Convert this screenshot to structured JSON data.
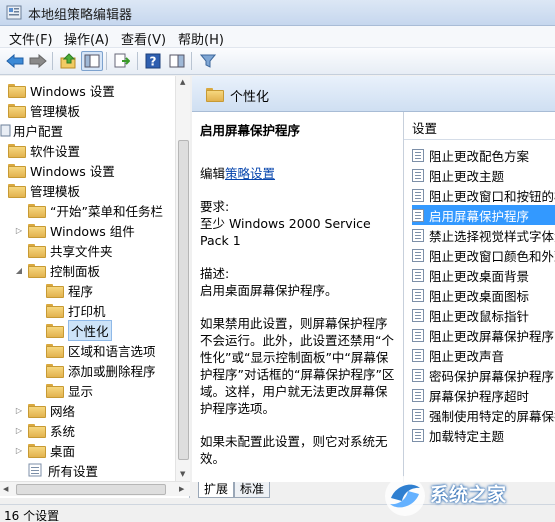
{
  "window": {
    "title": "本地组策略编辑器"
  },
  "menu": [
    "文件(F)",
    "操作(A)",
    "查看(V)",
    "帮助(H)"
  ],
  "icons": {
    "app": "policy-editor-icon",
    "back": "back-arrow-icon",
    "forward": "forward-arrow-icon",
    "up": "up-folder-icon",
    "show_hide_tree": "console-tree-icon",
    "export": "export-list-icon",
    "help": "help-icon",
    "show": "show-pane-icon",
    "filter": "filter-icon",
    "folder": "folder-icon",
    "setting": "setting-icon"
  },
  "tree": [
    {
      "label": "Windows 设置"
    },
    {
      "label": "管理模板"
    },
    {
      "label": "用户配置"
    },
    {
      "label": "软件设置"
    },
    {
      "label": "Windows 设置"
    },
    {
      "label": "管理模板"
    },
    {
      "label": "“开始”菜单和任务栏"
    },
    {
      "label": "Windows 组件"
    },
    {
      "label": "共享文件夹"
    },
    {
      "label": "控制面板"
    },
    {
      "label": "程序"
    },
    {
      "label": "打印机"
    },
    {
      "label": "个性化"
    },
    {
      "label": "区域和语言选项"
    },
    {
      "label": "添加或删除程序"
    },
    {
      "label": "显示"
    },
    {
      "label": "网络"
    },
    {
      "label": "系统"
    },
    {
      "label": "桌面"
    },
    {
      "label": "所有设置"
    }
  ],
  "detail": {
    "header_title": "个性化",
    "setting_title": "启用屏幕保护程序",
    "edit_prefix": "编辑",
    "edit_link": "策略设置",
    "requirements_label": "要求:",
    "requirements_value": "至少 Windows 2000 Service Pack 1",
    "description_label": "描述:",
    "description_value": "启用桌面屏幕保护程序。",
    "para1": "如果禁用此设置，则屏幕保护程序不会运行。此外，此设置还禁用“个性化”或“显示控制面板”中“屏幕保护程序”对话框的“屏幕保护程序”区域。这样，用户就无法更改屏幕保护程序选项。",
    "para2": "如果未配置此设置，则它对系统无效。"
  },
  "list": {
    "column_header": "设置",
    "items": [
      "阻止更改配色方案",
      "阻止更改主题",
      "阻止更改窗口和按钮的样式",
      "启用屏幕保护程序",
      "禁止选择视觉样式字体大小",
      "阻止更改窗口颜色和外观",
      "阻止更改桌面背景",
      "阻止更改桌面图标",
      "阻止更改鼠标指针",
      "阻止更改屏幕保护程序",
      "阻止更改声音",
      "密码保护屏幕保护程序",
      "屏幕保护程序超时",
      "强制使用特定的屏幕保护程序",
      "加载特定主题"
    ],
    "selected_index": 3
  },
  "tabs": [
    "扩展",
    "标准"
  ],
  "status": {
    "text": "16 个设置"
  },
  "watermark": {
    "text": "系统之家"
  }
}
